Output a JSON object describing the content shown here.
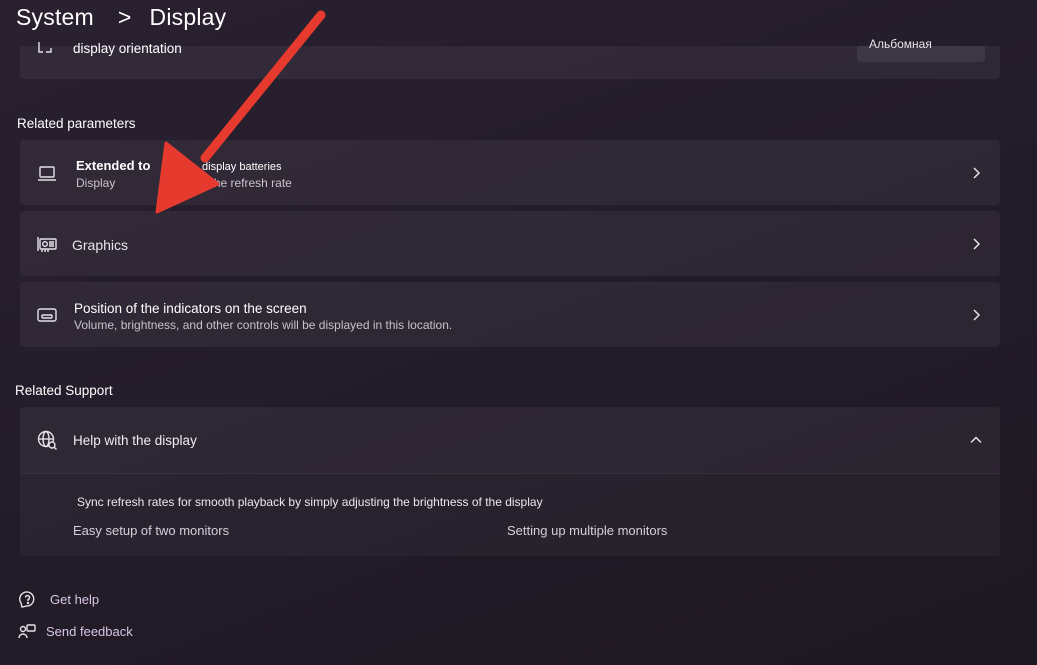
{
  "header": {
    "breadcrumb_root": "System",
    "breadcrumb_sep": ">",
    "breadcrumb_current": "Display"
  },
  "orientation": {
    "label": "display orientation",
    "value": "Альбомная"
  },
  "related_parameters": {
    "heading": "Related parameters",
    "items": [
      {
        "title_a": "Extended to",
        "title_b": "display batteries",
        "subtitle_a": "Display",
        "subtitle_b": "y, the refresh rate"
      },
      {
        "title": "Graphics"
      },
      {
        "title": "Position of the indicators on the screen",
        "subtitle": "Volume, brightness, and other controls will be displayed in this location."
      }
    ]
  },
  "related_support": {
    "heading": "Related Support",
    "help_title": "Help with the display",
    "description": "Sync refresh rates for smooth playback by simply adjusting the brightness of the display",
    "links": [
      "Easy setup of two monitors",
      "Setting up multiple monitors"
    ]
  },
  "footer": {
    "get_help": "Get help",
    "send_feedback": "Send feedback"
  },
  "colors": {
    "background": "#231c2a",
    "annotation_arrow": "#e63a2e"
  }
}
